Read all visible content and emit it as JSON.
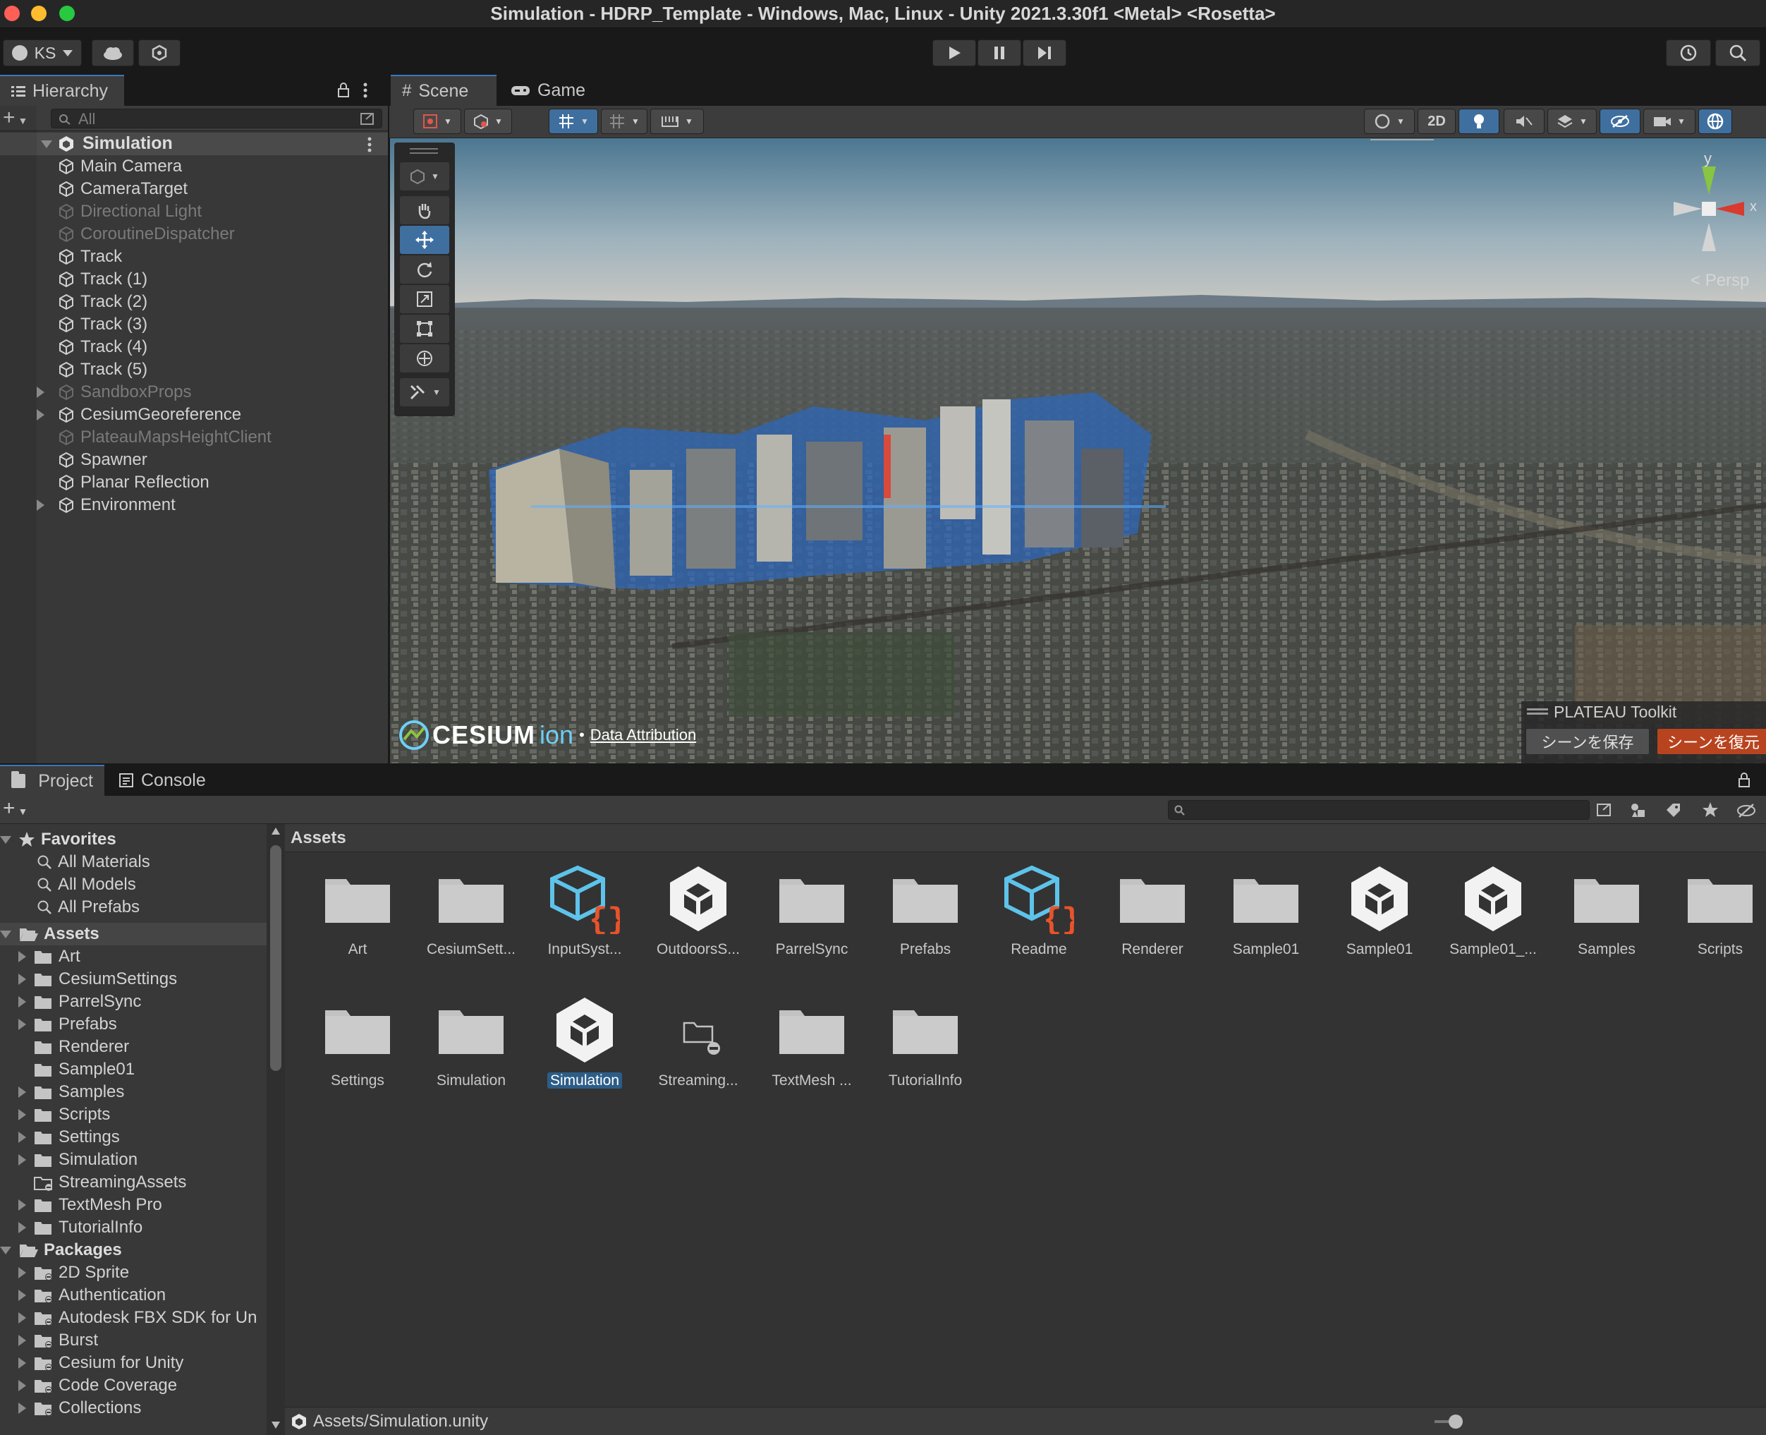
{
  "window": {
    "title": "Simulation - HDRP_Template - Windows, Mac, Linux - Unity 2021.3.30f1 <Metal> <Rosetta>"
  },
  "toolbar": {
    "account": "KS"
  },
  "hierarchy": {
    "tab": "Hierarchy",
    "search_placeholder": "All",
    "scene_name": "Simulation",
    "items": [
      {
        "label": "Main Camera",
        "active": true,
        "expandable": false
      },
      {
        "label": "CameraTarget",
        "active": true,
        "expandable": false
      },
      {
        "label": "Directional Light",
        "active": false,
        "expandable": false
      },
      {
        "label": "CoroutineDispatcher",
        "active": false,
        "expandable": false
      },
      {
        "label": "Track",
        "active": true,
        "expandable": false
      },
      {
        "label": "Track (1)",
        "active": true,
        "expandable": false
      },
      {
        "label": "Track (2)",
        "active": true,
        "expandable": false
      },
      {
        "label": "Track (3)",
        "active": true,
        "expandable": false
      },
      {
        "label": "Track (4)",
        "active": true,
        "expandable": false
      },
      {
        "label": "Track (5)",
        "active": true,
        "expandable": false
      },
      {
        "label": "SandboxProps",
        "active": false,
        "expandable": true
      },
      {
        "label": "CesiumGeoreference",
        "active": true,
        "expandable": true
      },
      {
        "label": "PlateauMapsHeightClient",
        "active": false,
        "expandable": false
      },
      {
        "label": "Spawner",
        "active": true,
        "expandable": false
      },
      {
        "label": "Planar Reflection",
        "active": true,
        "expandable": false
      },
      {
        "label": "Environment",
        "active": true,
        "expandable": true
      }
    ]
  },
  "scene_view": {
    "tabs": [
      "Scene",
      "Game"
    ],
    "btn_2d": "2D",
    "persp": "Persp",
    "axis_y": "y",
    "axis_x": "x",
    "cesium_logo": "CESIUM",
    "cesium_ion": "ion",
    "data_attribution": "Data Attribution",
    "plateau_title": "PLATEAU Toolkit",
    "plateau_save": "シーンを保存",
    "plateau_restore": "シーンを復元"
  },
  "project": {
    "tabs": [
      "Project",
      "Console"
    ],
    "favorites": {
      "title": "Favorites",
      "items": [
        "All Materials",
        "All Models",
        "All Prefabs"
      ]
    },
    "assets_title": "Assets",
    "asset_folders": [
      {
        "label": "Art",
        "expandable": true
      },
      {
        "label": "CesiumSettings",
        "expandable": true
      },
      {
        "label": "ParrelSync",
        "expandable": true
      },
      {
        "label": "Prefabs",
        "expandable": true
      },
      {
        "label": "Renderer",
        "expandable": false
      },
      {
        "label": "Sample01",
        "expandable": false
      },
      {
        "label": "Samples",
        "expandable": true
      },
      {
        "label": "Scripts",
        "expandable": true
      },
      {
        "label": "Settings",
        "expandable": true
      },
      {
        "label": "Simulation",
        "expandable": true
      },
      {
        "label": "StreamingAssets",
        "expandable": false
      },
      {
        "label": "TextMesh Pro",
        "expandable": true
      },
      {
        "label": "TutorialInfo",
        "expandable": true
      }
    ],
    "packages_title": "Packages",
    "packages": [
      "2D Sprite",
      "Authentication",
      "Autodesk FBX SDK for Un",
      "Burst",
      "Cesium for Unity",
      "Code Coverage",
      "Collections"
    ],
    "breadcrumb": "Assets",
    "grid": [
      {
        "label": "Art",
        "kind": "folder"
      },
      {
        "label": "CesiumSett...",
        "kind": "folder"
      },
      {
        "label": "InputSyst...",
        "kind": "script-asset"
      },
      {
        "label": "OutdoorsS...",
        "kind": "unity-scene"
      },
      {
        "label": "ParrelSync",
        "kind": "folder"
      },
      {
        "label": "Prefabs",
        "kind": "folder"
      },
      {
        "label": "Readme",
        "kind": "script-asset"
      },
      {
        "label": "Renderer",
        "kind": "folder"
      },
      {
        "label": "Sample01",
        "kind": "folder"
      },
      {
        "label": "Sample01",
        "kind": "unity-scene"
      },
      {
        "label": "Sample01_...",
        "kind": "unity-scene"
      },
      {
        "label": "Samples",
        "kind": "folder"
      },
      {
        "label": "Scripts",
        "kind": "folder"
      },
      {
        "label": "Settings",
        "kind": "folder"
      },
      {
        "label": "Simulation",
        "kind": "folder"
      },
      {
        "label": "Simulation",
        "kind": "unity-scene-selected"
      },
      {
        "label": "Streaming...",
        "kind": "empty-folder"
      },
      {
        "label": "TextMesh ...",
        "kind": "folder"
      },
      {
        "label": "TutorialInfo",
        "kind": "folder"
      }
    ],
    "status_path": "Assets/Simulation.unity"
  }
}
